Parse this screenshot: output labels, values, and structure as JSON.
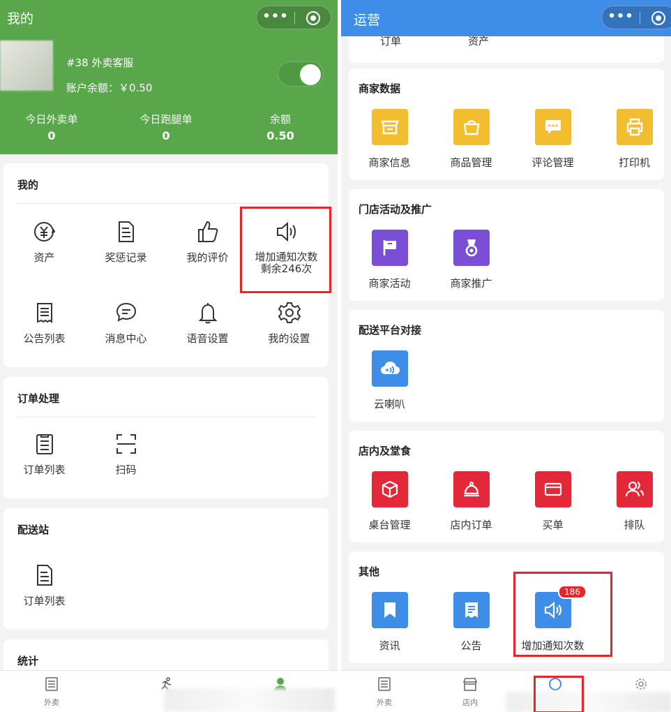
{
  "left": {
    "header": {
      "title": "我的",
      "user_tag": "#38 外卖客服",
      "balance_label": "账户余额：￥0.50",
      "stats": [
        {
          "label": "今日外卖单",
          "value": "0"
        },
        {
          "label": "今日跑腿单",
          "value": "0"
        },
        {
          "label": "余额",
          "value": "0.50"
        }
      ],
      "toggle_on": true
    },
    "mine": {
      "title": "我的",
      "items": [
        {
          "label": "资产",
          "icon": "yen-icon"
        },
        {
          "label": "奖惩记录",
          "icon": "document-icon"
        },
        {
          "label": "我的评价",
          "icon": "thumbs-up-icon"
        },
        {
          "label": "增加通知次数",
          "sub": "剩余246次",
          "icon": "speaker-icon"
        },
        {
          "label": "公告列表",
          "icon": "list-doc-icon"
        },
        {
          "label": "消息中心",
          "icon": "chat-bubble-icon"
        },
        {
          "label": "语音设置",
          "icon": "bell-icon"
        },
        {
          "label": "我的设置",
          "icon": "gear-icon"
        }
      ]
    },
    "orders": {
      "title": "订单处理",
      "items": [
        {
          "label": "订单列表",
          "icon": "clipboard-icon"
        },
        {
          "label": "扫码",
          "icon": "scan-icon"
        }
      ]
    },
    "delivery": {
      "title": "配送站",
      "items": [
        {
          "label": "订单列表",
          "icon": "document-icon"
        }
      ]
    },
    "stats_card": {
      "title": "统计"
    },
    "tabbar": [
      {
        "label": "外卖",
        "icon": "receipt-icon"
      }
    ]
  },
  "right": {
    "header": {
      "title": "运营"
    },
    "top_partial": [
      "订单",
      "资产"
    ],
    "merchant": {
      "title": "商家数据",
      "color": "#f2bd2e",
      "items": [
        {
          "label": "商家信息",
          "icon": "store-icon"
        },
        {
          "label": "商品管理",
          "icon": "bag-icon"
        },
        {
          "label": "评论管理",
          "icon": "comment-icon"
        },
        {
          "label": "打印机",
          "icon": "printer-icon"
        }
      ]
    },
    "promo": {
      "title": "门店活动及推广",
      "color": "#7a4fd6",
      "items": [
        {
          "label": "商家活动",
          "icon": "flag-icon"
        },
        {
          "label": "商家推广",
          "icon": "medal-icon"
        }
      ]
    },
    "platform": {
      "title": "配送平台对接",
      "items": [
        {
          "label": "云喇叭",
          "icon": "cloud-speaker-icon"
        }
      ]
    },
    "dinein": {
      "title": "店内及堂食",
      "color": "#e3283a",
      "items": [
        {
          "label": "桌台管理",
          "icon": "cube-icon"
        },
        {
          "label": "店内订单",
          "icon": "cloche-icon"
        },
        {
          "label": "买单",
          "icon": "card-icon"
        },
        {
          "label": "排队",
          "icon": "people-icon"
        }
      ]
    },
    "other": {
      "title": "其他",
      "color": "#3e8de6",
      "items": [
        {
          "label": "资讯",
          "icon": "bookmark-icon"
        },
        {
          "label": "公告",
          "icon": "notice-icon"
        },
        {
          "label": "增加通知次数",
          "icon": "speaker-icon",
          "badge": "186"
        }
      ]
    },
    "tabbar": [
      {
        "label": "外卖",
        "icon": "receipt-icon"
      },
      {
        "label": "店内",
        "icon": "shop-icon"
      }
    ]
  },
  "colors": {
    "green": "#58a84b",
    "blue": "#3e8de6",
    "highlight": "#e8262a"
  }
}
